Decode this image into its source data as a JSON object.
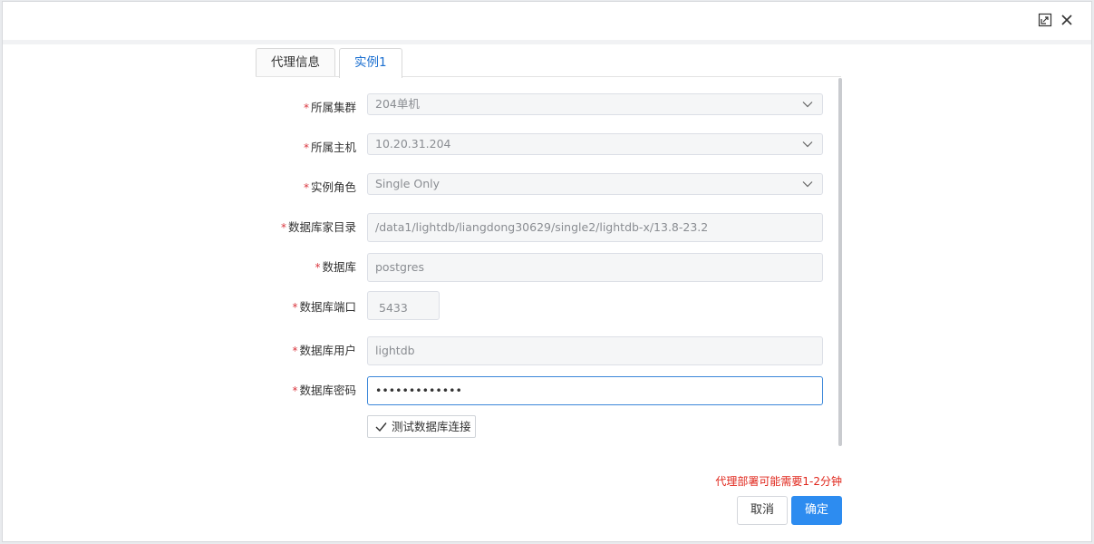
{
  "tabs": [
    {
      "label": "代理信息",
      "active": false
    },
    {
      "label": "实例1",
      "active": true
    }
  ],
  "form": {
    "cluster": {
      "label": "所属集群",
      "value": "204单机"
    },
    "host": {
      "label": "所属主机",
      "value": "10.20.31.204"
    },
    "role": {
      "label": "实例角色",
      "value": "Single Only"
    },
    "home_dir": {
      "label": "数据库家目录",
      "value": "/data1/lightdb/liangdong30629/single2/lightdb-x/13.8-23.2"
    },
    "database": {
      "label": "数据库",
      "value": "postgres"
    },
    "port": {
      "label": "数据库端口",
      "value": "5433"
    },
    "user": {
      "label": "数据库用户",
      "value": "lightdb"
    },
    "password": {
      "label": "数据库密码",
      "value": "•••••••••••••"
    },
    "required_mark": "*"
  },
  "test_button": {
    "label": "测试数据库连接"
  },
  "notice": "代理部署可能需要1-2分钟",
  "footer": {
    "cancel_label": "取消",
    "ok_label": "确定"
  },
  "colors": {
    "primary": "#2d8cf0",
    "warning": "#e0261b",
    "required": "#d9363e"
  },
  "icons": {
    "maximize": "maximize-icon",
    "close": "close-icon",
    "dropdown": "chevron-down-icon",
    "check": "check-icon"
  }
}
